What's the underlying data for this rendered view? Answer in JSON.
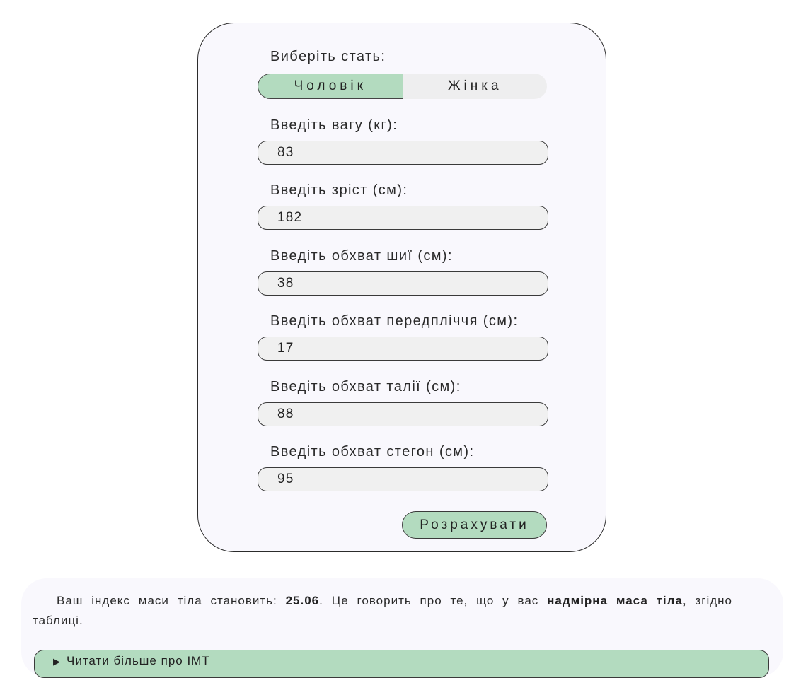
{
  "form": {
    "gender_label": "Виберіть стать:",
    "gender_options": [
      "Чоловік",
      "Жінка"
    ],
    "gender_selected": "Чоловік",
    "fields": [
      {
        "label": "Введіть вагу (кг):",
        "value": "83"
      },
      {
        "label": "Введіть зріст (см):",
        "value": "182"
      },
      {
        "label": "Введіть обхват шиї (см):",
        "value": "38"
      },
      {
        "label": "Введіть обхват передпліччя (см):",
        "value": "17"
      },
      {
        "label": "Введіть обхват талії (см):",
        "value": "88"
      },
      {
        "label": "Введіть обхват стегон (см):",
        "value": "95"
      }
    ],
    "calculate_label": "Розрахувати"
  },
  "result": {
    "prefix": "Ваш індекс маси тіла становить: ",
    "bmi_value": "25.06",
    "middle": ". Це говорить про те, що у вас ",
    "category": "надмірна маса тіла",
    "suffix": ", згідно таблиці.",
    "details_arrow": "▶",
    "details_label": "Читати більше про ІМТ"
  },
  "colors": {
    "accent": "#b3dbbf",
    "card_bg": "#f9f8fd",
    "field_bg": "#f0f0f0"
  }
}
